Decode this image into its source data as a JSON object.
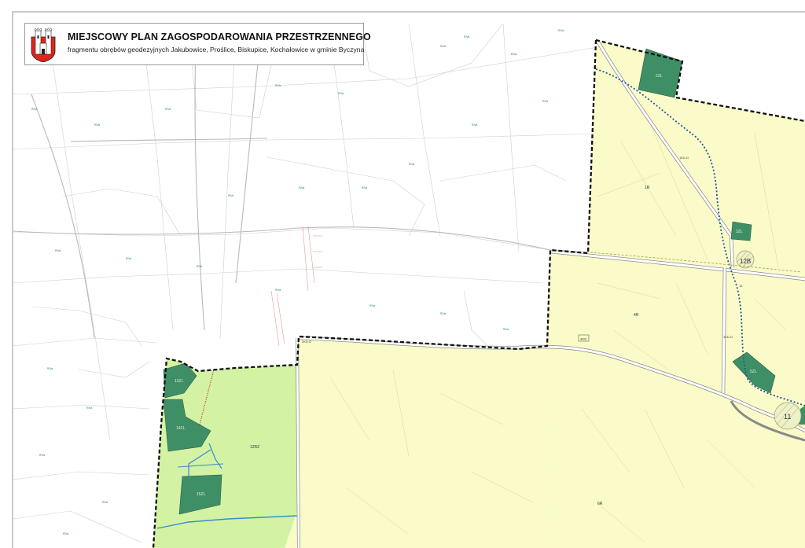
{
  "header": {
    "title": "MIEJSCOWY PLAN ZAGOSPODAROWANIA PRZESTRZENNEGO",
    "subtitle": "fragmentu obrębów geodezyjnych Jakubowice, Proślice, Biskupice, Kochałowice w gminie Byczyna"
  },
  "crest": {
    "icon": "town-crest-icon",
    "shield_color": "#e2231a",
    "tower_color": "#ffffff"
  },
  "zones": [
    {
      "symbol": "1R",
      "type": "agricultural",
      "color": "#fafbc8"
    },
    {
      "symbol": "4R",
      "type": "agricultural",
      "color": "#fafbc8"
    },
    {
      "symbol": "6R",
      "type": "agricultural",
      "color": "#fafbc8"
    },
    {
      "symbol": "12RZ",
      "type": "meadow",
      "color": "#d3f2a4"
    },
    {
      "symbol": "2ZL",
      "type": "forest",
      "color": "#3f8f66"
    },
    {
      "symbol": "3ZL",
      "type": "forest",
      "color": "#3f8f66"
    },
    {
      "symbol": "5ZL",
      "type": "forest",
      "color": "#3f8f66"
    },
    {
      "symbol": "13ZL",
      "type": "forest",
      "color": "#3f8f66"
    },
    {
      "symbol": "14ZL",
      "type": "forest",
      "color": "#3f8f66"
    },
    {
      "symbol": "15ZL",
      "type": "forest",
      "color": "#3f8f66"
    },
    {
      "symbol": "4WZ",
      "type": "water-management",
      "color": "#fafbc8"
    }
  ],
  "roads": [
    {
      "symbol": "1KD-D"
    },
    {
      "symbol": "2KD-D"
    },
    {
      "symbol": "3KD-D"
    },
    {
      "symbol": "16"
    }
  ],
  "markers": [
    {
      "symbol": "11"
    },
    {
      "symbol": "12B"
    }
  ],
  "colors": {
    "boundary": "#111111",
    "river": "#2255a8",
    "stream": "#3a8bd0",
    "parcel_line": "#c8c8c8",
    "parcel_number": "#1f8a5a"
  }
}
